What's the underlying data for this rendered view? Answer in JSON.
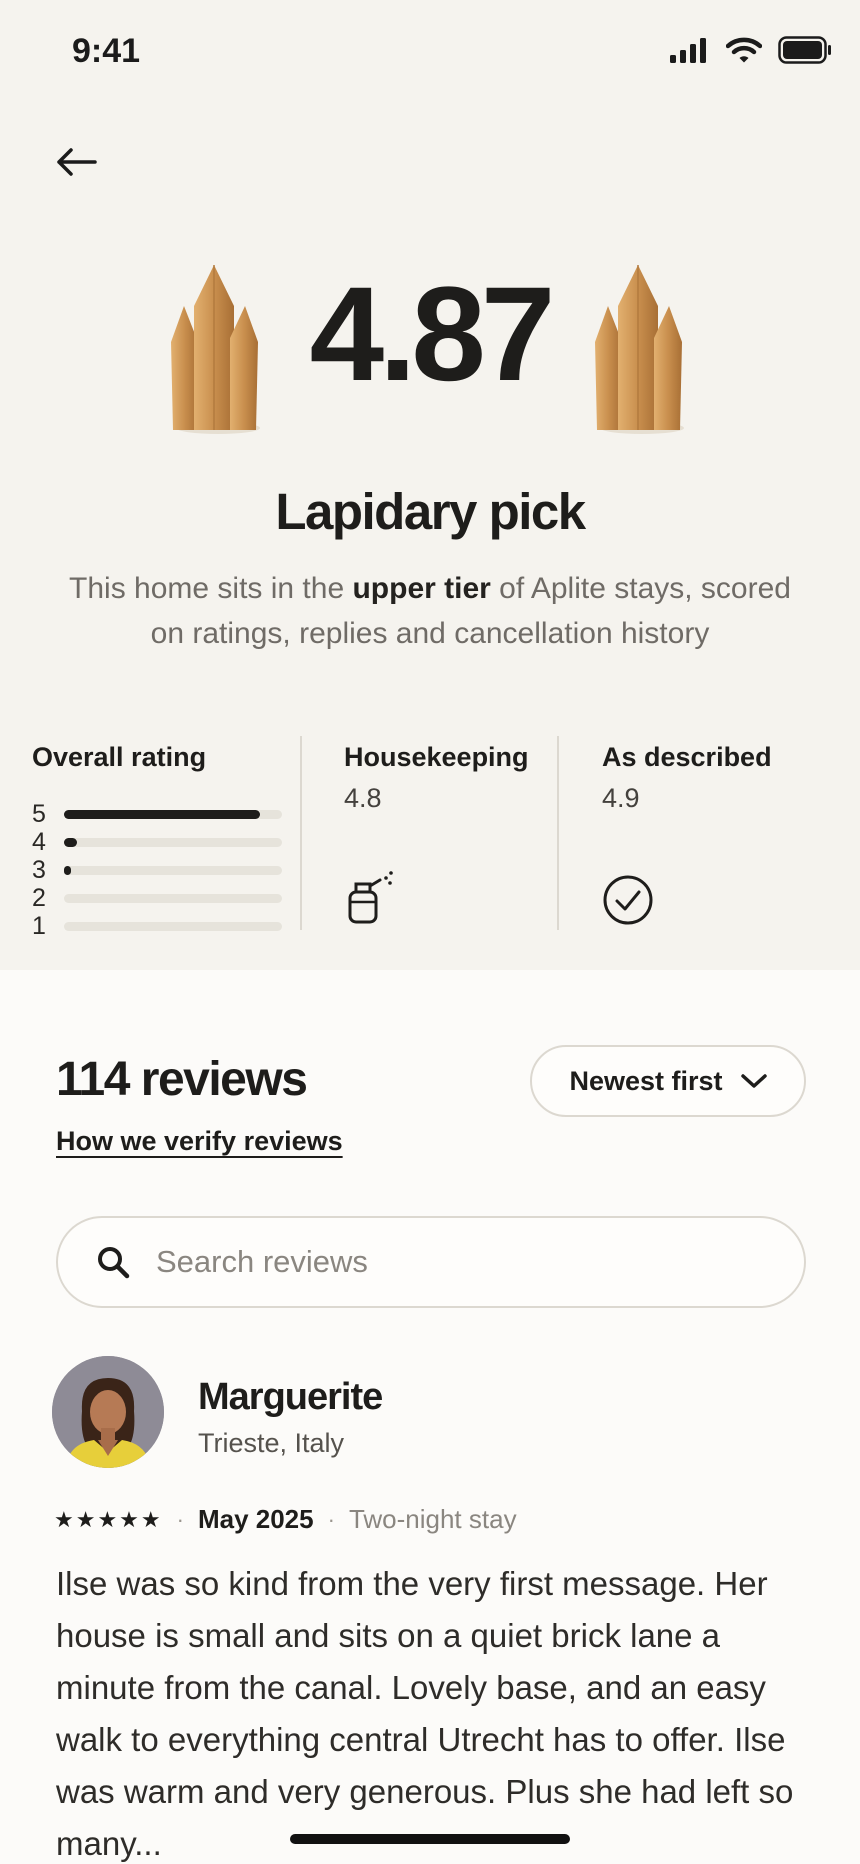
{
  "status_bar": {
    "time": "9:41"
  },
  "hero": {
    "rating": "4.87",
    "badge_title": "Lapidary pick",
    "description_before": "This home sits in the ",
    "description_bold": "upper tier",
    "description_after": " of Aplite stays, scored on ratings, replies and cancellation history"
  },
  "stats": {
    "overall": {
      "title": "Overall rating",
      "distribution": [
        {
          "label": "5",
          "fraction": 0.9
        },
        {
          "label": "4",
          "fraction": 0.06
        },
        {
          "label": "3",
          "fraction": 0.03
        },
        {
          "label": "2",
          "fraction": 0.0
        },
        {
          "label": "1",
          "fraction": 0.0
        }
      ]
    },
    "housekeeping": {
      "title": "Housekeeping",
      "value": "4.8",
      "icon": "spray-bottle-icon"
    },
    "as_described": {
      "title": "As described",
      "value": "4.9",
      "icon": "check-circle-icon"
    }
  },
  "reviews": {
    "count_label": "114 reviews",
    "verify_link": "How we verify reviews",
    "sort_label": "Newest first",
    "search_placeholder": "Search reviews",
    "items": [
      {
        "name": "Marguerite",
        "location": "Trieste, Italy",
        "stars": "★★★★★",
        "date": "May 2025",
        "stay": "Two-night stay",
        "text": "Ilse was so kind from the very first message. Her house is small and sits on a quiet brick lane a minute from the canal. Lovely base, and an easy walk to everything central Utrecht has to offer. Ilse was warm and very generous. Plus she had left so many..."
      }
    ]
  },
  "colors": {
    "accent_gold": "#c98f4e",
    "text_dark": "#1e1d1b",
    "top_bg": "#f5f3ee"
  }
}
